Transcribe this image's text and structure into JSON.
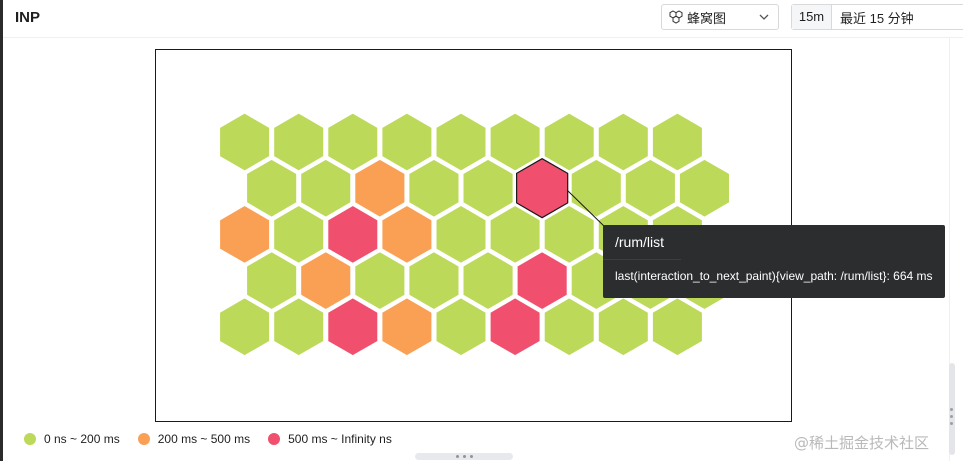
{
  "panel": {
    "title": "INP",
    "viz_select": {
      "value": "蜂窝图",
      "icon": "honeycomb-icon"
    },
    "time_picker": {
      "short": "15m",
      "long": "最近 15 分钟"
    }
  },
  "colors": {
    "good": "#bcd95a",
    "warn": "#f9a055",
    "bad": "#f0506e",
    "tooltip_bg": "#2b2d2f"
  },
  "legend": [
    {
      "label": "0 ns ~ 200 ms",
      "color": "#bcd95a"
    },
    {
      "label": "200 ms ~ 500 ms",
      "color": "#f9a055"
    },
    {
      "label": "500 ms ~ Infinity ns",
      "color": "#f0506e"
    }
  ],
  "chart_data": {
    "type": "heatmap",
    "subtype": "honeycomb",
    "rows": [
      [
        "good",
        "good",
        "good",
        "good",
        "good",
        "good",
        "good",
        "good",
        "good"
      ],
      [
        "good",
        "good",
        "warn",
        "good",
        "good",
        "bad",
        "good",
        "good",
        "good"
      ],
      [
        "warn",
        "good",
        "bad",
        "warn",
        "good",
        "good",
        "good",
        "good",
        "good"
      ],
      [
        "good",
        "warn",
        "good",
        "good",
        "good",
        "bad",
        "good",
        "good",
        "good"
      ],
      [
        "good",
        "good",
        "bad",
        "warn",
        "good",
        "bad",
        "good",
        "good",
        "good"
      ]
    ],
    "highlighted": {
      "row": 1,
      "col": 5
    },
    "legend_position": "bottom-left"
  },
  "tooltip": {
    "title": "/rum/list",
    "body": "last(interaction_to_next_paint){view_path: /rum/list}: 664 ms"
  },
  "watermark": "@稀土掘金技术社区"
}
